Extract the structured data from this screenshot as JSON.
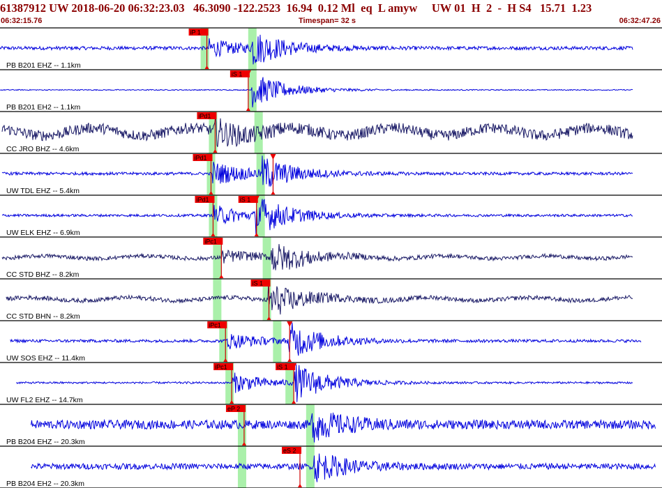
{
  "header": {
    "text": "61387912 UW 2018-06-20 06:32:23.03   46.3090 -122.2523  16.94  0.12 Ml  eq  L amyw     UW 01  H  2  -  H S4   15.71  1.23",
    "start_time": "06:32:15.76",
    "timespan": "Timespan=  32 s",
    "end_time": "06:32:47.26"
  },
  "colors": {
    "trace_blue": "#0000dd",
    "trace_navy": "#1a1a66",
    "pick_box": "#ee0000",
    "pick_line": "#cc0000",
    "window_green": "#aaf0aa",
    "divider": "#000000",
    "label": "#000000",
    "header_text": "#8b0000"
  },
  "chart_data": {
    "type": "seismogram",
    "x_unit": "s",
    "x_range": [
      0,
      32
    ],
    "traces": [
      {
        "label": "PB B201 EHZ -- 1.1km",
        "color": "blue",
        "amp": 1.0,
        "noise": 0.18,
        "start": 0.0,
        "end": 30.6,
        "picks": [
          {
            "text": "iP 1",
            "t": 10.0,
            "tri": false
          }
        ],
        "windows": [
          9.9,
          12.2
        ],
        "events": [
          [
            10.1,
            0.9
          ],
          [
            12.2,
            1.6
          ]
        ]
      },
      {
        "label": "PB B201 EH2 -- 1.1km",
        "color": "blue",
        "amp": 1.0,
        "noise": 0.05,
        "start": 0.0,
        "end": 30.6,
        "picks": [
          {
            "text": "iS 1",
            "t": 12.0,
            "tri": true
          }
        ],
        "windows": [
          12.2
        ],
        "events": [
          [
            12.2,
            1.8
          ]
        ]
      },
      {
        "label": "CC JRO BHZ -- 4.6km",
        "color": "navy",
        "amp": 1.0,
        "noise": 0.55,
        "start": 0.1,
        "end": 30.6,
        "picks": [
          {
            "text": "iPd1",
            "t": 10.4,
            "tri": false
          }
        ],
        "windows": [
          10.3,
          12.5
        ],
        "events": [
          [
            10.4,
            1.1
          ]
        ]
      },
      {
        "label": "UW TDL EHZ -- 5.4km",
        "color": "blue",
        "amp": 1.0,
        "noise": 0.15,
        "start": 0.1,
        "end": 30.6,
        "picks": [
          {
            "text": "iPd1",
            "t": 10.2,
            "tri": false
          },
          {
            "text": "",
            "t": 13.2,
            "tri": true
          }
        ],
        "windows": [
          10.2,
          12.6
        ],
        "events": [
          [
            10.3,
            1.2
          ],
          [
            12.7,
            1.5
          ]
        ]
      },
      {
        "label": "UW ELK EHZ -- 6.9km",
        "color": "blue",
        "amp": 1.0,
        "noise": 0.13,
        "start": 0.1,
        "end": 30.6,
        "picks": [
          {
            "text": "iPd1",
            "t": 10.3,
            "tri": false
          },
          {
            "text": "iS 1",
            "t": 12.4,
            "tri": true
          }
        ],
        "windows": [
          10.3,
          12.6
        ],
        "events": [
          [
            10.4,
            1.0
          ],
          [
            12.4,
            1.8
          ]
        ]
      },
      {
        "label": "CC STD BHZ -- 8.2km",
        "color": "navy",
        "amp": 1.0,
        "noise": 0.2,
        "start": 0.1,
        "end": 30.6,
        "picks": [
          {
            "text": "iPc1",
            "t": 10.7,
            "tri": false
          }
        ],
        "windows": [
          10.5,
          12.9
        ],
        "events": [
          [
            10.7,
            0.6
          ],
          [
            13.1,
            1.6
          ]
        ]
      },
      {
        "label": "CC STD BHN -- 8.2km",
        "color": "navy",
        "amp": 1.0,
        "noise": 0.22,
        "start": 0.3,
        "end": 30.6,
        "picks": [
          {
            "text": "iS 1",
            "t": 13.0,
            "tri": false
          }
        ],
        "windows": [
          10.5,
          12.9
        ],
        "events": [
          [
            13.0,
            1.8
          ]
        ]
      },
      {
        "label": "UW SOS EHZ -- 11.4km",
        "color": "blue",
        "amp": 1.0,
        "noise": 0.15,
        "start": 0.5,
        "end": 31.0,
        "picks": [
          {
            "text": "iPc1",
            "t": 10.9,
            "tri": false
          },
          {
            "text": "",
            "t": 14.0,
            "tri": true
          }
        ],
        "windows": [
          10.8,
          13.4
        ],
        "events": [
          [
            11.0,
            0.8
          ],
          [
            14.0,
            1.8
          ]
        ]
      },
      {
        "label": "UW FL2 EHZ -- 14.7km",
        "color": "blue",
        "amp": 1.0,
        "noise": 0.1,
        "start": 0.8,
        "end": 30.6,
        "picks": [
          {
            "text": "iPc1",
            "t": 11.2,
            "tri": false
          },
          {
            "text": "iS 1",
            "t": 14.2,
            "tri": true
          }
        ],
        "windows": [
          11.1,
          14.0
        ],
        "events": [
          [
            11.3,
            1.0
          ],
          [
            14.3,
            1.8
          ]
        ]
      },
      {
        "label": "PB B204 EHZ -- 20.3km",
        "color": "blue",
        "amp": 1.0,
        "noise": 0.45,
        "start": 1.5,
        "end": 31.7,
        "picks": [
          {
            "text": "eP 2",
            "t": 11.8,
            "tri": false
          }
        ],
        "windows": [
          11.7,
          15.0
        ],
        "events": [
          [
            15.1,
            1.5
          ]
        ]
      },
      {
        "label": "PB B204 EH2 -- 20.3km",
        "color": "blue",
        "amp": 1.0,
        "noise": 0.3,
        "start": 1.5,
        "end": 31.7,
        "picks": [
          {
            "text": "eS 2",
            "t": 14.5,
            "tri": false
          }
        ],
        "windows": [
          11.7,
          15.0
        ],
        "events": [
          [
            15.2,
            1.5
          ]
        ]
      }
    ]
  }
}
